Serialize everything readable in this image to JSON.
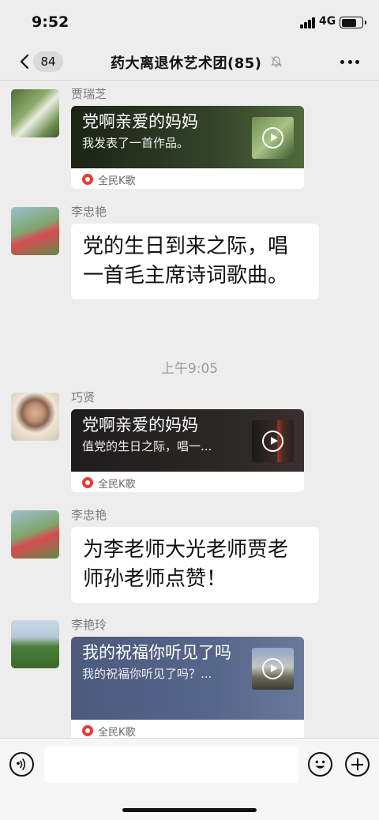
{
  "status_bar": {
    "time": "9:52",
    "network": "4G"
  },
  "header": {
    "unread_count": "84",
    "title": "药大离退休艺术团(85)"
  },
  "messages": [
    {
      "sender": "贾瑞芝",
      "type": "card",
      "card_title": "党啊亲爱的妈妈",
      "card_subtitle": "我发表了一首作品。",
      "app_name": "全民K歌"
    },
    {
      "sender": "李忠艳",
      "type": "text",
      "text": "党的生日到来之际，唱一首毛主席诗词歌曲。"
    },
    {
      "type": "time",
      "text": "上午9:05"
    },
    {
      "sender": "巧贤",
      "type": "card",
      "card_title": "党啊亲爱的妈妈",
      "card_subtitle": "值党的生日之际，唱一...",
      "app_name": "全民K歌"
    },
    {
      "sender": "李忠艳",
      "type": "text",
      "text": "为李老师大光老师贾老师孙老师点赞！"
    },
    {
      "sender": "李艳玲",
      "type": "card",
      "card_title": "我的祝福你听见了吗",
      "card_subtitle": "我的祝福你听见了吗？...",
      "app_name": "全民K歌"
    }
  ],
  "input_bar": {
    "placeholder": ""
  },
  "icons": {
    "back": "chevron-left-icon",
    "mute": "bell-slash-icon",
    "more": "more-dots-icon",
    "voice": "voice-icon",
    "emoji": "smiley-icon",
    "plus": "plus-circle-icon",
    "play": "play-icon",
    "app": "kge-app-icon"
  },
  "colors": {
    "background": "#ededed",
    "bubble": "#ffffff",
    "k_song_red": "#e53b3b"
  }
}
